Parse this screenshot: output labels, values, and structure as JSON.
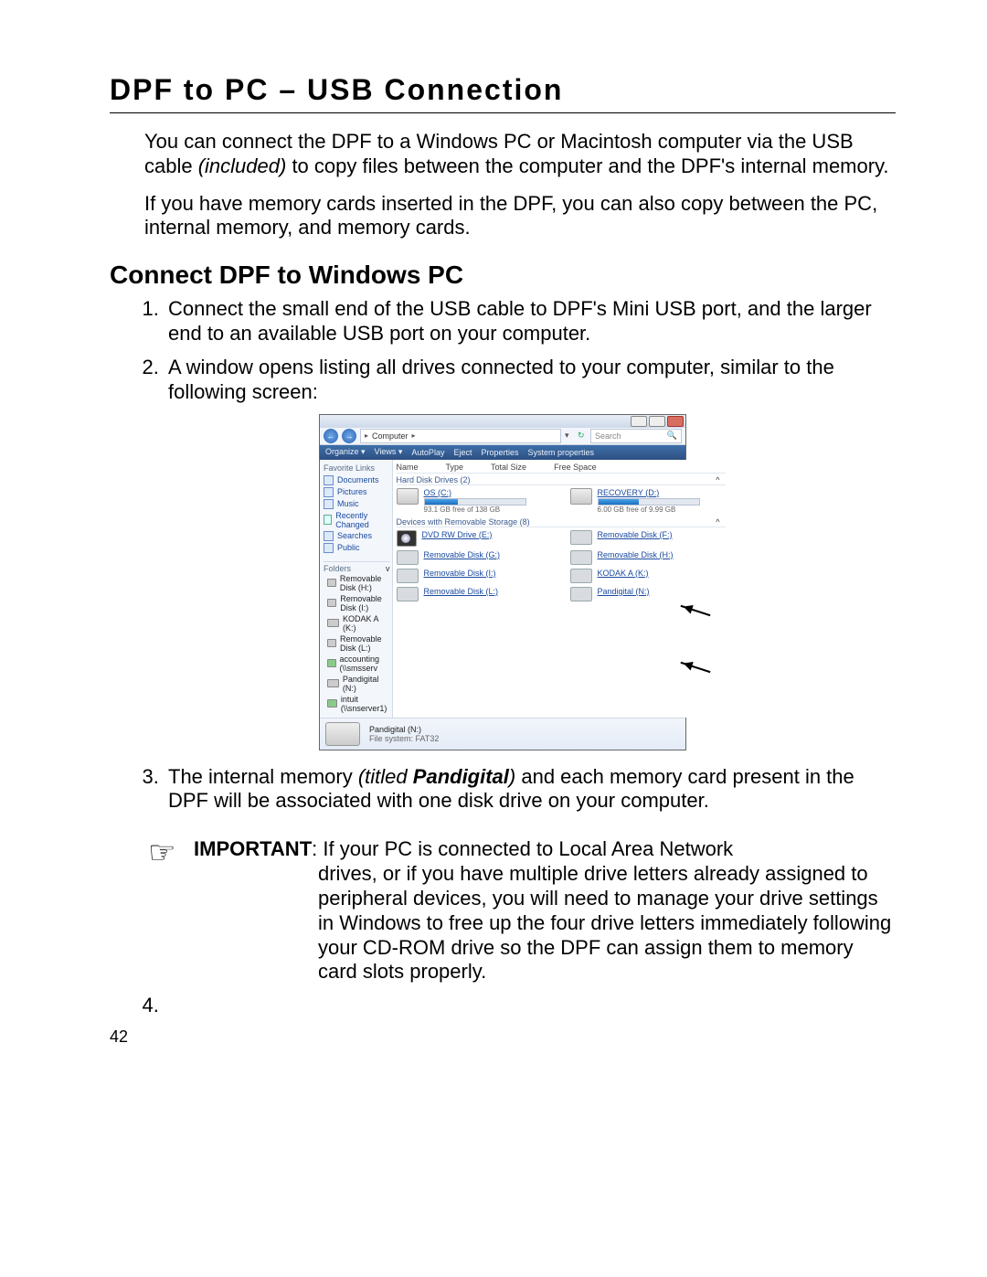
{
  "page": {
    "title": "DPF to PC – USB Connection",
    "intro1a": "You can connect the DPF to a Windows PC or Macintosh computer via the USB cable ",
    "intro1b": "(included)",
    "intro1c": " to copy files between the computer and the DPF's internal memory.",
    "intro2": "If you have memory cards inserted in the DPF, you can also copy between the PC, internal memory, and memory cards.",
    "sub": "Connect DPF to Windows PC",
    "step1": "Connect the small end of the USB cable to DPF's Mini USB port, and the larger end to an available USB port on your computer.",
    "step2": "A window opens listing all drives connected to your computer, similar to the following screen:",
    "step3a": "The internal memory ",
    "step3b": "(titled ",
    "step3c": "Pandigital",
    "step3d": ")",
    "step3e": " and each memory card present in the DPF will be associated with one disk drive on your computer.",
    "step4": "",
    "note": {
      "hand": "☞",
      "important_label": "IMPORTANT",
      "first": ": If your PC is connected to Local Area Network",
      "rest": "drives, or if you have multiple drive letters already assigned to peripheral devices, you will need to manage your drive settings in Windows to free up the four drive letters immediately following your CD-ROM drive so the DPF can assign them to memory card slots properly."
    },
    "pagenum": "42"
  },
  "shot": {
    "nav": {
      "back": "←",
      "fwd": "→"
    },
    "breadcrumb": {
      "icon": "▸",
      "computer": "Computer",
      "sep": "▸"
    },
    "search": {
      "placeholder": "Search",
      "glass": "🔍"
    },
    "toolbar": {
      "organize": "Organize ▾",
      "views": "Views ▾",
      "autoplay": "AutoPlay",
      "eject": "Eject",
      "properties": "Properties",
      "system": "System properties"
    },
    "sidebar": {
      "fav_header": "Favorite Links",
      "favs": [
        "Documents",
        "Pictures",
        "Music",
        "Recently Changed",
        "Searches",
        "Public"
      ],
      "folders_header": "Folders",
      "folders_caret": "v",
      "folders": [
        "Removable Disk (H:)",
        "Removable Disk (I:)",
        "KODAK    A (K:)",
        "Removable Disk (L:)",
        "accounting (\\\\smsserv",
        "Pandigital (N:)",
        "intuit (\\\\snserver1)"
      ]
    },
    "content": {
      "cols": [
        "Name",
        "Type",
        "Total Size",
        "Free Space"
      ],
      "group1": "Hard Disk Drives (2)",
      "osc": {
        "name": "OS (C:)",
        "free": "93.1 GB free of 138 GB",
        "fill": 33
      },
      "rec": {
        "name": "RECOVERY (D:)",
        "free": "6.00 GB free of 9.99 GB",
        "fill": 40
      },
      "group2": "Devices with Removable Storage (8)",
      "rows": [
        [
          "DVD RW Drive (E:)",
          "Removable Disk (F:)"
        ],
        [
          "Removable Disk (G:)",
          "Removable Disk (H:)"
        ],
        [
          "Removable Disk (I:)",
          "KODAK    A (K:)"
        ],
        [
          "Removable Disk (L:)",
          "Pandigital (N:)"
        ]
      ],
      "caret": "^"
    },
    "status": {
      "name": "Pandigital (N:)",
      "fs": "File system: FAT32"
    }
  }
}
